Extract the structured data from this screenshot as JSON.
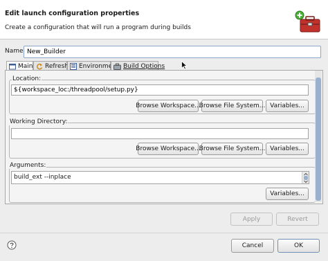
{
  "dialog": {
    "title": "Edit launch configuration properties",
    "subtitle": "Create a configuration that will run a program during builds",
    "header_icon": "builder-toolbox-add-icon"
  },
  "name": {
    "label": "Name:",
    "value": "New_Builder"
  },
  "tabs": [
    {
      "label": "Main",
      "icon": "main-tab-icon",
      "active": true
    },
    {
      "label": "Refresh",
      "icon": "refresh-icon"
    },
    {
      "label": "Environment",
      "icon": "environment-icon"
    },
    {
      "label": "Build Options",
      "icon": "build-options-icon"
    }
  ],
  "location": {
    "label": "Location:",
    "value": "${workspace_loc:/threadpool/setup.py}",
    "buttons": [
      "Browse Workspace...",
      "Browse File System...",
      "Variables..."
    ]
  },
  "working_directory": {
    "label": "Working Directory:",
    "value": "",
    "buttons": [
      "Browse Workspace...",
      "Browse File System...",
      "Variables..."
    ]
  },
  "arguments": {
    "label": "Arguments:",
    "value": "build_ext --inplace",
    "button": "Variables..."
  },
  "actions": {
    "apply": "Apply",
    "revert": "Revert",
    "cancel": "Cancel",
    "ok": "OK"
  },
  "icons": {
    "help": "help-icon",
    "cursor": "mouse-cursor-icon"
  }
}
